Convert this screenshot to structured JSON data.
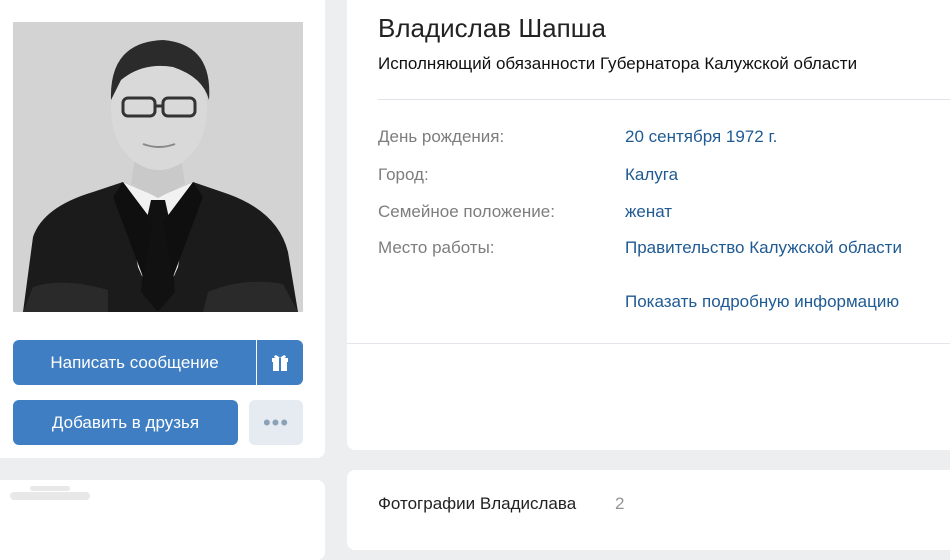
{
  "profile": {
    "name": "Владислав Шапша",
    "status": "Исполняющий обязанности Губернатора Калужской области"
  },
  "info": [
    {
      "label": "День рождения:",
      "value": "20 сентября 1972 г."
    },
    {
      "label": "Город:",
      "value": "Калуга"
    },
    {
      "label": "Семейное положение:",
      "value": "женат"
    },
    {
      "label": "Место работы:",
      "value": "Правительство Калужской области"
    }
  ],
  "show_more_label": "Показать подробную информацию",
  "actions": {
    "message_label": "Написать сообщение",
    "add_friend_label": "Добавить в друзья",
    "more_label": "•••",
    "gift_icon": "gift-icon"
  },
  "photos": {
    "title": "Фотографии Владислава",
    "count": "2"
  },
  "colors": {
    "accent": "#3f7ec2",
    "link": "#1f5a93",
    "label": "#7d7d7d"
  }
}
